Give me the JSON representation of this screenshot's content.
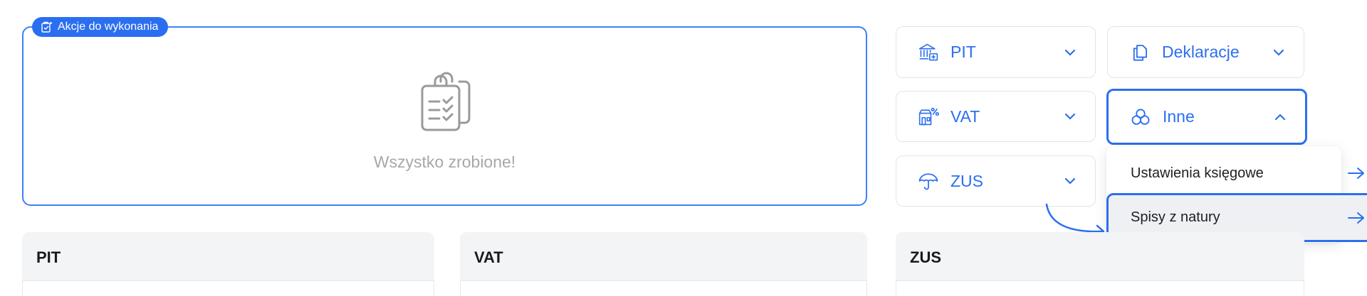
{
  "actions": {
    "badge_label": "Akcje do wykonania",
    "empty_text": "Wszystko zrobione!"
  },
  "dropdowns": [
    {
      "label": "PIT",
      "icon": "bank-building-icon",
      "expanded": false
    },
    {
      "label": "Deklaracje",
      "icon": "documents-copy-icon",
      "expanded": false
    },
    {
      "label": "VAT",
      "icon": "percent-shop-icon",
      "expanded": false
    },
    {
      "label": "Inne",
      "icon": "circles-cluster-icon",
      "expanded": true
    },
    {
      "label": "ZUS",
      "icon": "umbrella-icon",
      "expanded": false
    }
  ],
  "menu": {
    "items": [
      {
        "label": "Ustawienia księgowe"
      },
      {
        "label": "Spisy z natury"
      }
    ]
  },
  "cards": [
    {
      "title": "PIT"
    },
    {
      "title": "VAT"
    },
    {
      "title": "ZUS"
    }
  ],
  "colors": {
    "accent": "#2b6ff0",
    "panel_border": "#3b82f6",
    "muted_text": "#a8a8a8",
    "card_header_bg": "#f3f4f6"
  }
}
